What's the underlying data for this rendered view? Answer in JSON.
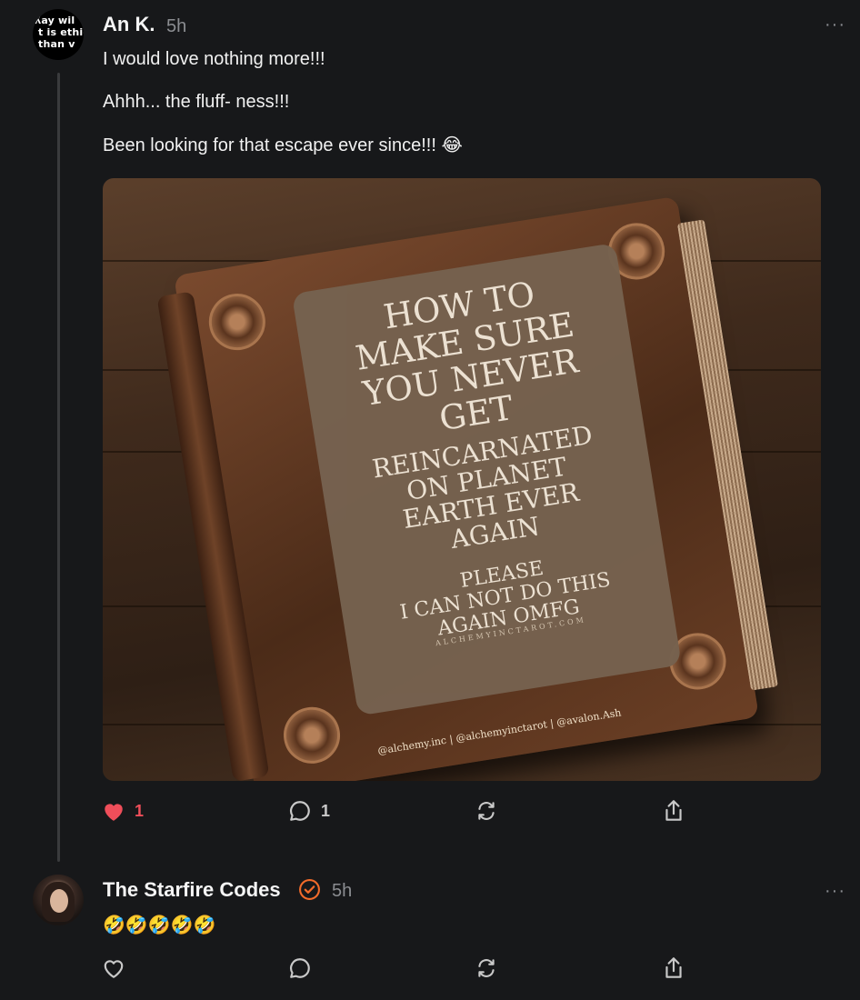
{
  "post": {
    "author": "An K.",
    "time": "5h",
    "avatar_text": "ʎay wil\n t is ethic\n than v",
    "more": "···",
    "lines": [
      "I would love nothing more!!!",
      "Ahhh... the fluff- ness!!!",
      "Been looking for that escape ever since!!! 😂"
    ],
    "image": {
      "title_lines": "HOW TO\nMAKE SURE\nYOU NEVER\nGET",
      "mid_lines": "REINCARNATED\nON PLANET\nEARTH EVER\nAGAIN",
      "small_lines": "PLEASE\nI CAN NOT DO THIS\nAGAIN OMFG",
      "url": "ALCHEMYINCTAROT.COM",
      "credit": "@alchemy.inc | @alchemyinctarot | @avalon.Ash"
    },
    "actions": {
      "likes": "1",
      "comments": "1",
      "liked": true
    }
  },
  "reply": {
    "author": "The Starfire Codes",
    "verified": true,
    "time": "5h",
    "more": "···",
    "text": "🤣🤣🤣🤣🤣"
  },
  "colors": {
    "background": "#17181a",
    "like": "#ef4e5a",
    "verified": "#f26b2a",
    "muted": "#8b8d91"
  }
}
